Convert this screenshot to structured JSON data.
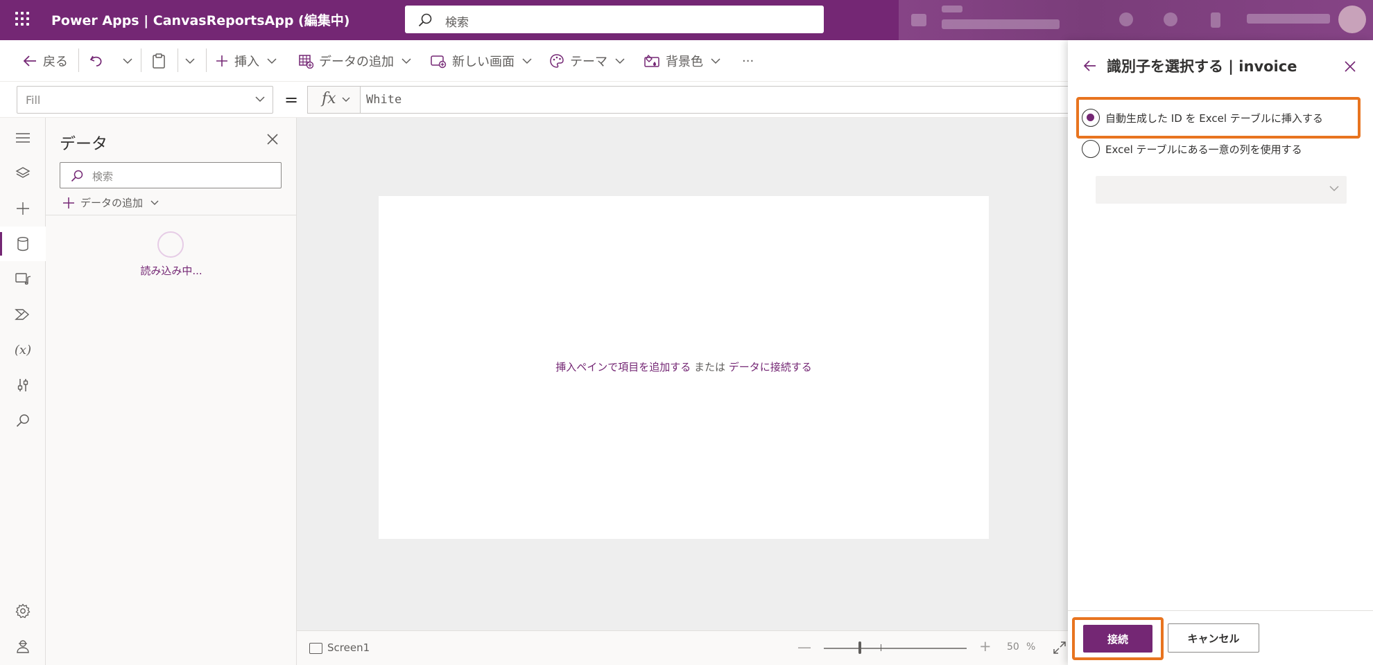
{
  "header": {
    "app_title": "Power Apps  |  CanvasReportsApp (編集中)",
    "search_placeholder": "検索"
  },
  "toolbar": {
    "back_label": "戻る",
    "insert_label": "挿入",
    "add_data_label": "データの追加",
    "new_screen_label": "新しい画面",
    "theme_label": "テーマ",
    "background_label": "背景色",
    "more_label": "···"
  },
  "formula_bar": {
    "property": "Fill",
    "equals": "=",
    "fx": "fx",
    "formula": "White"
  },
  "data_pane": {
    "title": "データ",
    "search_placeholder": "検索",
    "add_data_label": "データの追加",
    "loading_text": "読み込み中..."
  },
  "canvas": {
    "hint_link1": "挿入ペインで項目を追加する",
    "hint_mid": " または ",
    "hint_link2": "データに接続する"
  },
  "status_bar": {
    "screen_name": "Screen1",
    "zoom_value": "50",
    "zoom_unit": "%"
  },
  "identifier_panel": {
    "title": "識別子を選択する | invoice",
    "option_auto": "自動生成した ID を Excel テーブルに挿入する",
    "option_unique": "Excel テーブルにある一意の列を使用する",
    "selected_option": "option_auto",
    "connect_label": "接続",
    "cancel_label": "キャンセル"
  },
  "colors": {
    "brand": "#742774",
    "highlight": "#e8741f"
  },
  "icons": [
    "waffle-icon",
    "search-icon",
    "back-arrow-icon",
    "undo-icon",
    "paste-icon",
    "plus-icon",
    "table-add-icon",
    "new-screen-icon",
    "palette-icon",
    "background-icon",
    "chevron-down-icon",
    "close-icon",
    "hamburger-icon",
    "layers-icon",
    "database-icon",
    "media-icon",
    "flow-icon",
    "variable-icon",
    "tools-icon",
    "settings-icon",
    "virtual-agent-icon",
    "fit-to-window-icon"
  ]
}
